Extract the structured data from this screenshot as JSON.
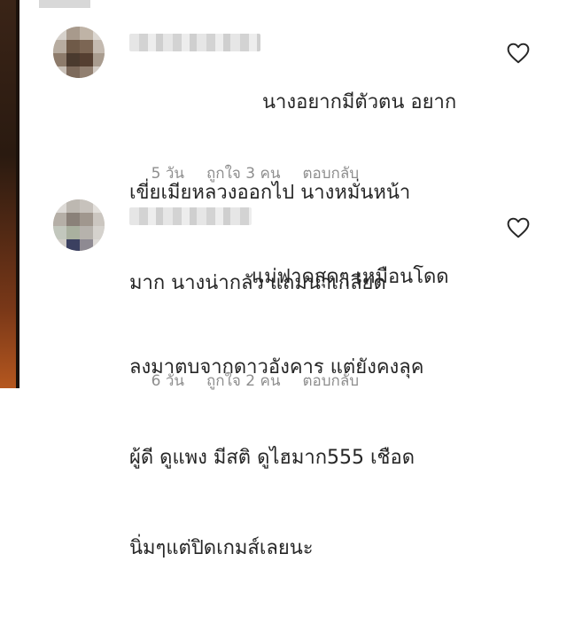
{
  "comments": [
    {
      "text_lines": [
        "นางอยากมีตัวตน อยาก",
        "เขี่ยเมียหลวงออกไป นางหมั่นหน้า",
        "มาก นางน่ากลัว แถมน่าเกลียด"
      ],
      "time": "5 วัน",
      "likes": "ถูกใจ 3 คน",
      "reply": "ตอบกลับ",
      "like_icon": "heart-outline-icon"
    },
    {
      "text_lines": [
        "แม่ฟาดสุดๆ เหมือนโดด",
        "ลงมาตบจากดาวอังคาร แต่ยังคงลุค",
        "ผู้ดี ดูแพง มีสติ ดูไฮมาก555 เชือด",
        "นิ่มๆแต่ปิดเกมส์เลยนะ"
      ],
      "time": "6 วัน",
      "likes": "ถูกใจ 2 คน",
      "reply": "ตอบกลับ",
      "like_icon": "heart-outline-icon"
    }
  ]
}
